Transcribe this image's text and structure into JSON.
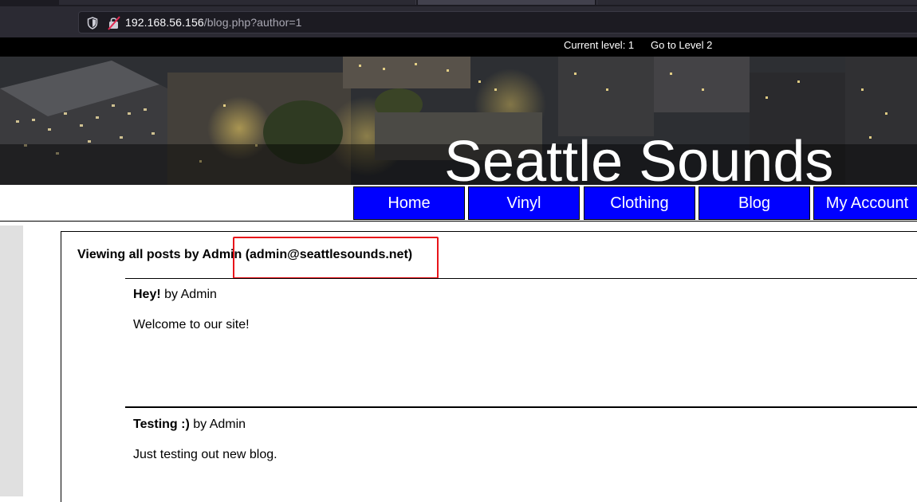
{
  "browser": {
    "url_host": "192.168.56.156",
    "url_path": "/blog.php?author=1"
  },
  "levelbar": {
    "current_level": "Current level: 1",
    "go_to_level": "Go to Level 2"
  },
  "site": {
    "title": "Seattle Sounds"
  },
  "nav": [
    {
      "label": "Home"
    },
    {
      "label": "Vinyl"
    },
    {
      "label": "Clothing"
    },
    {
      "label": "Blog"
    },
    {
      "label": "My Account"
    }
  ],
  "main": {
    "heading": "Viewing all posts by Admin (admin@seattlesounds.net)",
    "posts": [
      {
        "title": "Hey!",
        "byline": " by Admin",
        "body": "Welcome to our site!"
      },
      {
        "title": "Testing :)",
        "byline": " by Admin",
        "body": "Just testing out new blog."
      }
    ]
  },
  "colors": {
    "nav_bg": "#0000ff",
    "highlight": "#e8141a"
  }
}
